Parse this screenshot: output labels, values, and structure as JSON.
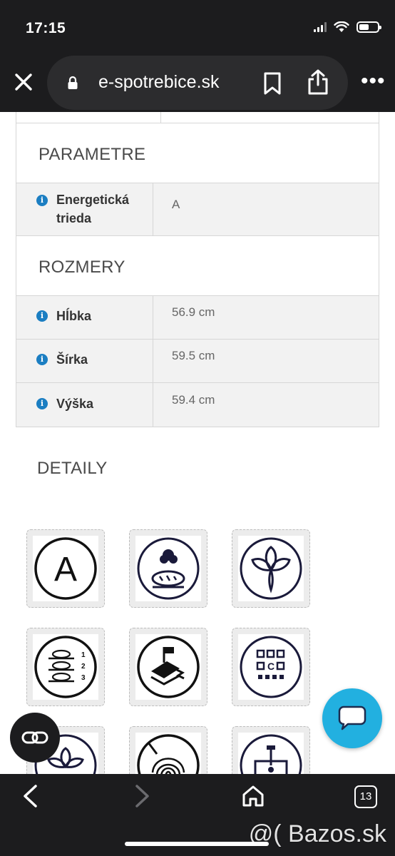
{
  "status": {
    "time": "17:15"
  },
  "browser": {
    "url": "e-spotrebice.sk",
    "tab_count": "13"
  },
  "sections": {
    "parametre": {
      "title": "PARAMETRE",
      "rows": [
        {
          "label": "Energetická trieda",
          "value": "A"
        }
      ]
    },
    "rozmery": {
      "title": "ROZMERY",
      "rows": [
        {
          "label": "Hĺbka",
          "value": "56.9 cm"
        },
        {
          "label": "Šírka",
          "value": "59.5 cm"
        },
        {
          "label": "Výška",
          "value": "59.4 cm"
        }
      ]
    }
  },
  "details": {
    "title": "DETAILY",
    "icons": [
      "energy-class-a-icon",
      "baking-bread-icon",
      "eco-fan-icon",
      "three-level-baking-icon",
      "steam-cleaning-icon",
      "control-panel-icon",
      "eco-mode-icon",
      "fingerprint-proof-icon",
      "hydrolytic-cleaning-icon"
    ],
    "energy_letter": "A"
  },
  "watermark": "@( Bazos.sk",
  "colors": {
    "info_blue": "#1b7ec2",
    "chat_blue": "#22b0e0",
    "chrome_dark": "#1c1c1e",
    "row_bg": "#f2f2f2"
  }
}
